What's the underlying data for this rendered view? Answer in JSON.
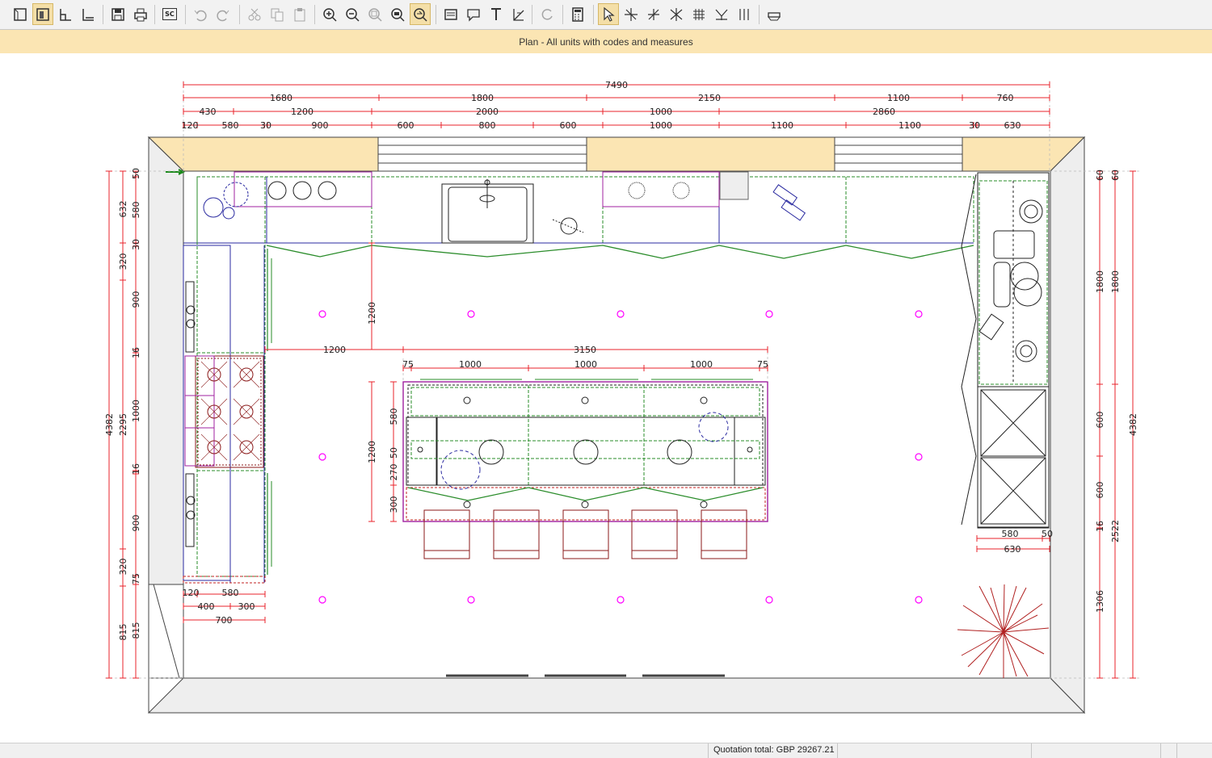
{
  "window": {
    "title": "Plan - All units with codes and measures"
  },
  "toolbar": {
    "groups": [
      [
        "room-view",
        "plan-view",
        "elevation-view",
        "wall-view"
      ],
      [
        "save",
        "print"
      ],
      [
        "sc-code"
      ],
      [
        "undo",
        "redo"
      ],
      [
        "cut",
        "copy",
        "paste"
      ],
      [
        "zoom-in",
        "zoom-out",
        "zoom-fit",
        "zoom-window",
        "zoom-previous"
      ],
      [
        "text-box",
        "comment",
        "text",
        "measure-text"
      ],
      [
        "refresh"
      ],
      [
        "calculator"
      ],
      [
        "select",
        "move",
        "rotate",
        "mirror",
        "grid",
        "align",
        "distribute"
      ],
      [
        "ceiling"
      ]
    ],
    "sc_label": "SC"
  },
  "plan": {
    "top_dims_row1": [
      "7490"
    ],
    "top_dims_row2": [
      "1680",
      "1800",
      "2150",
      "1100",
      "760"
    ],
    "top_dims_row3": [
      "430",
      "1200",
      "2000",
      "1000",
      "2860"
    ],
    "top_dims_row4": [
      "120",
      "580",
      "30",
      "900",
      "600",
      "800",
      "600",
      "1000",
      "1100",
      "1100",
      "30",
      "630"
    ],
    "left_dims_outer": [
      "4382"
    ],
    "left_dims_mid": [
      "632",
      "320",
      "2295",
      "320",
      "815"
    ],
    "left_dims_inner": [
      "50",
      "580",
      "30",
      "900",
      "16",
      "1000",
      "16",
      "900",
      "75",
      "815"
    ],
    "right_dims_inner": [
      "60",
      "1800",
      "600",
      "600",
      "16",
      "1306"
    ],
    "right_dims_mid": [
      "60",
      "1800",
      "2522"
    ],
    "right_dims_outer": [
      "4382"
    ],
    "island_dims_top": [
      "3150"
    ],
    "island_dims_row": [
      "75",
      "1000",
      "1000",
      "1000",
      "75"
    ],
    "island_dim_left": [
      "1200"
    ],
    "island_dim_vert": [
      "1200"
    ],
    "island_side_dims": [
      "1200",
      "580",
      "50",
      "270",
      "300"
    ],
    "bottom_left_dims": [
      "120",
      "580",
      "400",
      "300",
      "700"
    ],
    "right_tall_dims": [
      "580",
      "630",
      "50"
    ]
  },
  "status": {
    "quotation": "Quotation total: GBP 29267.21"
  },
  "colors": {
    "dimension": "#e8232b",
    "wall": "#fbe5b3",
    "outline": "#2a2aa0",
    "worktop": "#2a8c2a",
    "appliance": "#8b1a1a",
    "light": "#ff00ff"
  }
}
